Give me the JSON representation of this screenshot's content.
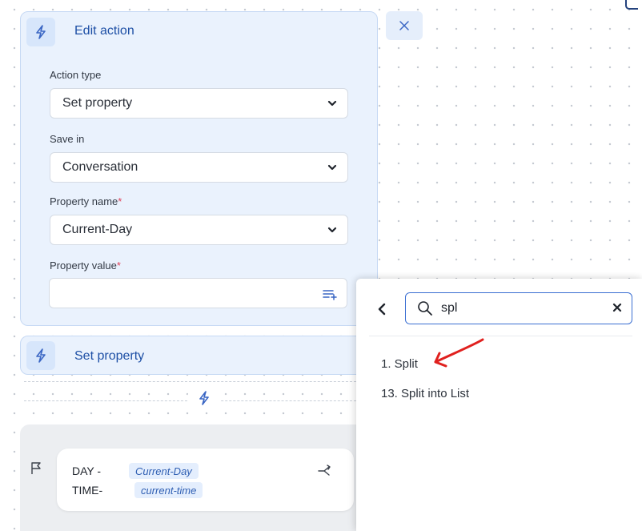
{
  "edit_panel": {
    "title": "Edit action",
    "action_type": {
      "label": "Action type",
      "value": "Set property"
    },
    "save_in": {
      "label": "Save in",
      "value": "Conversation"
    },
    "property_name": {
      "label": "Property name",
      "required_mark": "*",
      "value": "Current-Day"
    },
    "property_value": {
      "label": "Property value",
      "required_mark": "*",
      "value": ""
    }
  },
  "set_property_card": {
    "title": "Set property"
  },
  "node": {
    "line1_label": "DAY -",
    "line1_var": "Current-Day",
    "line2_label": "TIME-",
    "line2_var": "current-time"
  },
  "search_popup": {
    "query": "spl",
    "results": [
      {
        "label": "1. Split"
      },
      {
        "label": "13. Split into List"
      }
    ]
  },
  "colors": {
    "accent": "#1d4fa5",
    "panel_bg": "#eaf2fd",
    "required": "#e0435b",
    "annotation": "#e0201e"
  },
  "icons": [
    "bolt-icon",
    "close-icon",
    "chevron-down-icon",
    "list-add-icon",
    "flag-icon",
    "branch-icon",
    "back-arrow-icon",
    "search-icon",
    "clear-icon"
  ]
}
